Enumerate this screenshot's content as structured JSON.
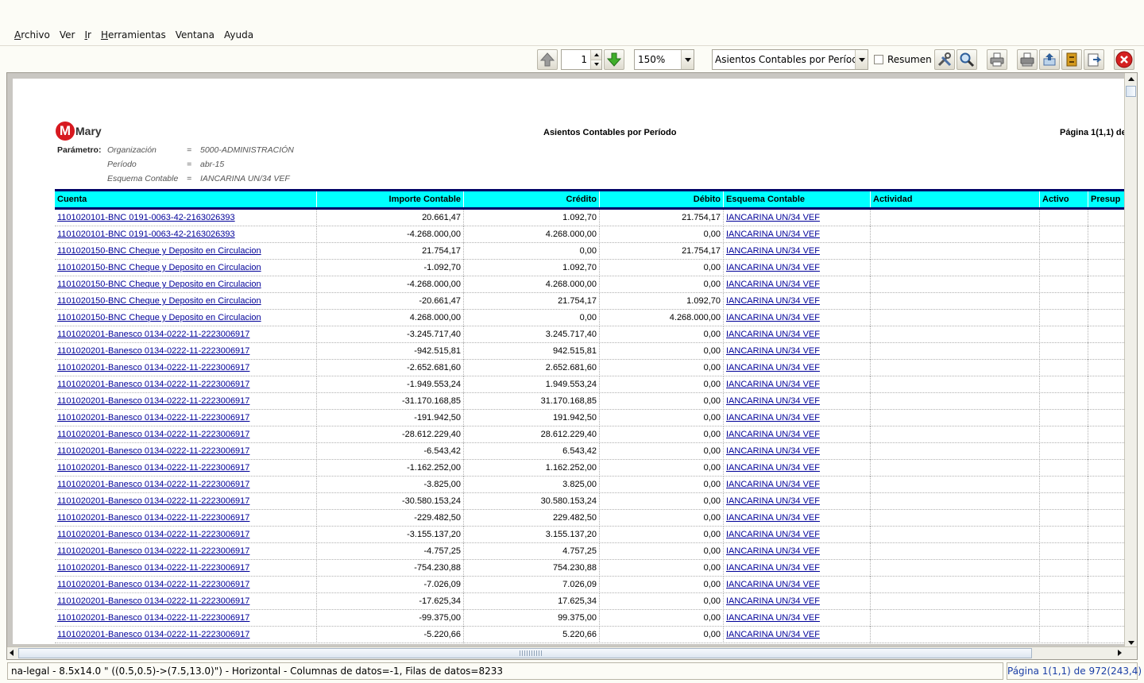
{
  "menubar": {
    "items": [
      {
        "mnemonic": "A",
        "rest": "rchivo"
      },
      {
        "mnemonic": "",
        "rest": "Ver"
      },
      {
        "mnemonic": "I",
        "rest": "r"
      },
      {
        "mnemonic": "H",
        "rest": "erramientas"
      },
      {
        "mnemonic": "",
        "rest": "Ventana"
      },
      {
        "mnemonic": "",
        "rest": "Ayuda"
      }
    ]
  },
  "toolbar": {
    "page_number": "1",
    "zoom": "150%",
    "report": "Asientos Contables por Período",
    "resumen_label": "Resumen"
  },
  "report": {
    "logo_text": "Mary",
    "title": "Asientos Contables por Período",
    "page_label": "Página 1(1,1) de",
    "params_label": "Parámetro:",
    "params": [
      {
        "name": "Organización",
        "eq": "=",
        "value": "5000-ADMINISTRACIÓN"
      },
      {
        "name": "Período",
        "eq": "=",
        "value": "abr-15"
      },
      {
        "name": "Esquema Contable",
        "eq": "=",
        "value": "IANCARINA UN/34 VEF"
      }
    ],
    "columns": [
      "Cuenta",
      "Importe Contable",
      "Crédito",
      "Débito",
      "Esquema Contable",
      "Actividad",
      "Activo",
      "Presup"
    ],
    "rows": [
      [
        "1101020101-BNC 0191-0063-42-2163026393",
        "20.661,47",
        "1.092,70",
        "21.754,17",
        "IANCARINA UN/34 VEF"
      ],
      [
        "1101020101-BNC 0191-0063-42-2163026393",
        "-4.268.000,00",
        "4.268.000,00",
        "0,00",
        "IANCARINA UN/34 VEF"
      ],
      [
        "1101020150-BNC Cheque y Deposito en Circulacion",
        "21.754,17",
        "0,00",
        "21.754,17",
        "IANCARINA UN/34 VEF"
      ],
      [
        "1101020150-BNC Cheque y Deposito en Circulacion",
        "-1.092,70",
        "1.092,70",
        "0,00",
        "IANCARINA UN/34 VEF"
      ],
      [
        "1101020150-BNC Cheque y Deposito en Circulacion",
        "-4.268.000,00",
        "4.268.000,00",
        "0,00",
        "IANCARINA UN/34 VEF"
      ],
      [
        "1101020150-BNC Cheque y Deposito en Circulacion",
        "-20.661,47",
        "21.754,17",
        "1.092,70",
        "IANCARINA UN/34 VEF"
      ],
      [
        "1101020150-BNC Cheque y Deposito en Circulacion",
        "4.268.000,00",
        "0,00",
        "4.268.000,00",
        "IANCARINA UN/34 VEF"
      ],
      [
        "1101020201-Banesco 0134-0222-11-2223006917",
        "-3.245.717,40",
        "3.245.717,40",
        "0,00",
        "IANCARINA UN/34 VEF"
      ],
      [
        "1101020201-Banesco 0134-0222-11-2223006917",
        "-942.515,81",
        "942.515,81",
        "0,00",
        "IANCARINA UN/34 VEF"
      ],
      [
        "1101020201-Banesco 0134-0222-11-2223006917",
        "-2.652.681,60",
        "2.652.681,60",
        "0,00",
        "IANCARINA UN/34 VEF"
      ],
      [
        "1101020201-Banesco 0134-0222-11-2223006917",
        "-1.949.553,24",
        "1.949.553,24",
        "0,00",
        "IANCARINA UN/34 VEF"
      ],
      [
        "1101020201-Banesco 0134-0222-11-2223006917",
        "-31.170.168,85",
        "31.170.168,85",
        "0,00",
        "IANCARINA UN/34 VEF"
      ],
      [
        "1101020201-Banesco 0134-0222-11-2223006917",
        "-191.942,50",
        "191.942,50",
        "0,00",
        "IANCARINA UN/34 VEF"
      ],
      [
        "1101020201-Banesco 0134-0222-11-2223006917",
        "-28.612.229,40",
        "28.612.229,40",
        "0,00",
        "IANCARINA UN/34 VEF"
      ],
      [
        "1101020201-Banesco 0134-0222-11-2223006917",
        "-6.543,42",
        "6.543,42",
        "0,00",
        "IANCARINA UN/34 VEF"
      ],
      [
        "1101020201-Banesco 0134-0222-11-2223006917",
        "-1.162.252,00",
        "1.162.252,00",
        "0,00",
        "IANCARINA UN/34 VEF"
      ],
      [
        "1101020201-Banesco 0134-0222-11-2223006917",
        "-3.825,00",
        "3.825,00",
        "0,00",
        "IANCARINA UN/34 VEF"
      ],
      [
        "1101020201-Banesco 0134-0222-11-2223006917",
        "-30.580.153,24",
        "30.580.153,24",
        "0,00",
        "IANCARINA UN/34 VEF"
      ],
      [
        "1101020201-Banesco 0134-0222-11-2223006917",
        "-229.482,50",
        "229.482,50",
        "0,00",
        "IANCARINA UN/34 VEF"
      ],
      [
        "1101020201-Banesco 0134-0222-11-2223006917",
        "-3.155.137,20",
        "3.155.137,20",
        "0,00",
        "IANCARINA UN/34 VEF"
      ],
      [
        "1101020201-Banesco 0134-0222-11-2223006917",
        "-4.757,25",
        "4.757,25",
        "0,00",
        "IANCARINA UN/34 VEF"
      ],
      [
        "1101020201-Banesco 0134-0222-11-2223006917",
        "-754.230,88",
        "754.230,88",
        "0,00",
        "IANCARINA UN/34 VEF"
      ],
      [
        "1101020201-Banesco 0134-0222-11-2223006917",
        "-7.026,09",
        "7.026,09",
        "0,00",
        "IANCARINA UN/34 VEF"
      ],
      [
        "1101020201-Banesco 0134-0222-11-2223006917",
        "-17.625,34",
        "17.625,34",
        "0,00",
        "IANCARINA UN/34 VEF"
      ],
      [
        "1101020201-Banesco 0134-0222-11-2223006917",
        "-99.375,00",
        "99.375,00",
        "0,00",
        "IANCARINA UN/34 VEF"
      ],
      [
        "1101020201-Banesco 0134-0222-11-2223006917",
        "-5.220,66",
        "5.220,66",
        "0,00",
        "IANCARINA UN/34 VEF"
      ]
    ]
  },
  "statusbar": {
    "left": "na-legal - 8.5x14.0 \" ((0.5,0.5)->(7.5,13.0)\") - Horizontal - Columnas de datos=-1, Filas de datos=8233",
    "right": "Página 1(1,1) de 972(243,4)"
  },
  "icons": {
    "prev_page": "arrow-up-icon",
    "next_page": "arrow-down-green-icon",
    "customize": "tools-icon",
    "find": "magnifier-icon",
    "print": "printer-icon",
    "print_preview": "printer-setup-icon",
    "send": "send-icon",
    "archive": "archive-icon",
    "export": "export-icon",
    "close": "close-icon"
  },
  "colors": {
    "header_bg": "#00ffff",
    "header_border": "#000066",
    "link": "#000099",
    "logo_red": "#d71920"
  }
}
